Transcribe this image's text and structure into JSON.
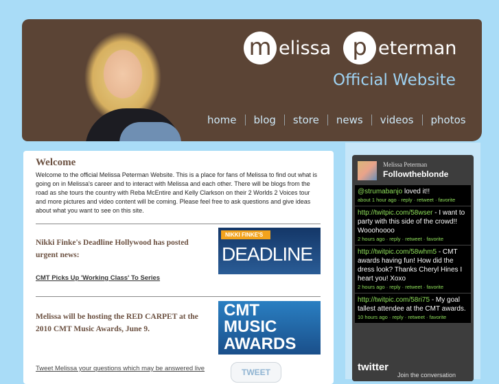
{
  "header": {
    "logo_first_initial": "m",
    "logo_first_rest": "elissa",
    "logo_last_initial": "p",
    "logo_last_rest": "eterman",
    "subtitle": "Official Website",
    "nav": [
      "home",
      "blog",
      "store",
      "news",
      "videos",
      "photos"
    ]
  },
  "main": {
    "welcome_title": "Welcome",
    "welcome_body": "Welcome to the official Melissa Peterman Website. This is a place for fans of Melissa to find out what is going on in Melissa's career and to interact with Melissa and each other. There will be blogs from the road as she tours the country with Reba McEntire and Kelly Clarkson on their 2 Worlds 2 Voices tour and more pictures and video content will be coming. Please feel free to ask questions and give ideas about what you want to see on this site.",
    "news1_text": "Nikki Finke's Deadline Hollywood has posted urgent news:",
    "news1_link": "CMT Picks Up 'Working Class' To Series",
    "deadline_small": "NIKKI FINKE'S",
    "deadline_big": "DEADLINE",
    "news2_text": "Melissa will be hosting the RED CARPET at the 2010 CMT Music Awards, June 9.",
    "cmt_line1": "CMT",
    "cmt_line2": "MUSIC",
    "cmt_line3": "AWARDS",
    "tweet_link": "Tweet Melissa your questions which may be answered live",
    "tweet_button": "TWEET"
  },
  "twitter": {
    "name": "Melissa Peterman",
    "handle": "Followtheblonde",
    "tweets": [
      {
        "lead": "@strumabanjo",
        "text": " loved it!!",
        "meta": "about 1 hour ago · reply · retweet · favorite"
      },
      {
        "lead": "http://twitpic.com/58wser",
        "text": " - I want to party with this side of the crowd!! Wooohoooo",
        "meta": "2 hours ago · reply · retweet · favorite"
      },
      {
        "lead": "http://twitpic.com/58whm5",
        "text": " - CMT awards having fun! How did the dress look? Thanks Cheryl Hines I heart you! Xoxo",
        "meta": "2 hours ago · reply · retweet · favorite"
      },
      {
        "lead": "http://twitpic.com/58ri75",
        "text": " - My goal tallest attendee at the CMT awards.",
        "meta": "10 hours ago · reply · retweet · favorite"
      }
    ],
    "footer_logo": "twitter",
    "footer_text": "Join the conversation"
  },
  "colors": {
    "background": "#a9dcf7",
    "banner": "#5b4435",
    "heading": "#6b5040",
    "tweet_link": "#8fe05a"
  }
}
